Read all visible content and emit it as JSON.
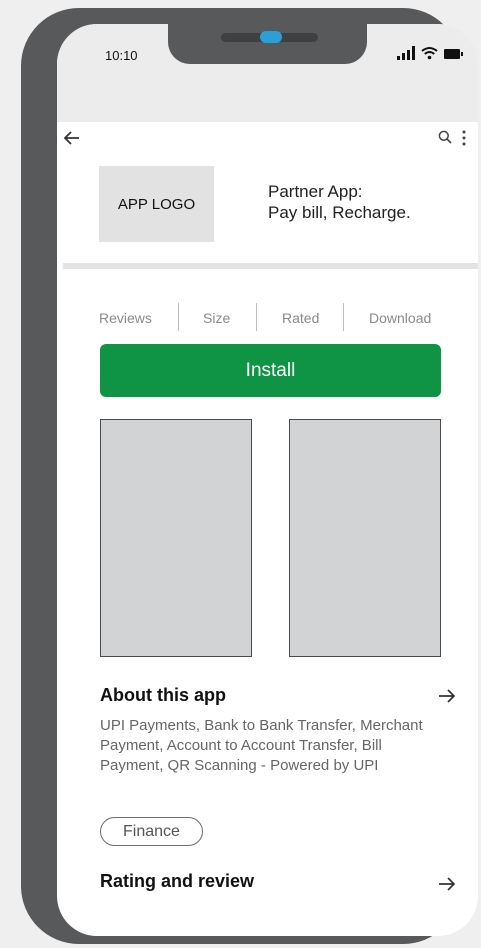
{
  "status_bar": {
    "time": "10:10"
  },
  "app": {
    "logo_text": "APP LOGO",
    "title_line1": "Partner App:",
    "title_line2": "Pay bill, Recharge."
  },
  "stats": [
    "Reviews",
    "Size",
    "Rated",
    "Download"
  ],
  "install_label": "Install",
  "about": {
    "title": "About this app",
    "description": "UPI Payments, Bank to Bank Transfer, Merchant Payment, Account to Account Transfer, Bill Payment, QR Scanning - Powered by UPI"
  },
  "category_chip": "Finance",
  "rating": {
    "title": "Rating and review"
  },
  "colors": {
    "install_bg": "#0f9445",
    "phone_frame": "#58595b",
    "camera": "#2b9fd8"
  },
  "icons": [
    "back-arrow-icon",
    "search-icon",
    "more-vert-icon",
    "signal-icon",
    "wifi-icon",
    "battery-icon",
    "arrow-right-icon"
  ]
}
